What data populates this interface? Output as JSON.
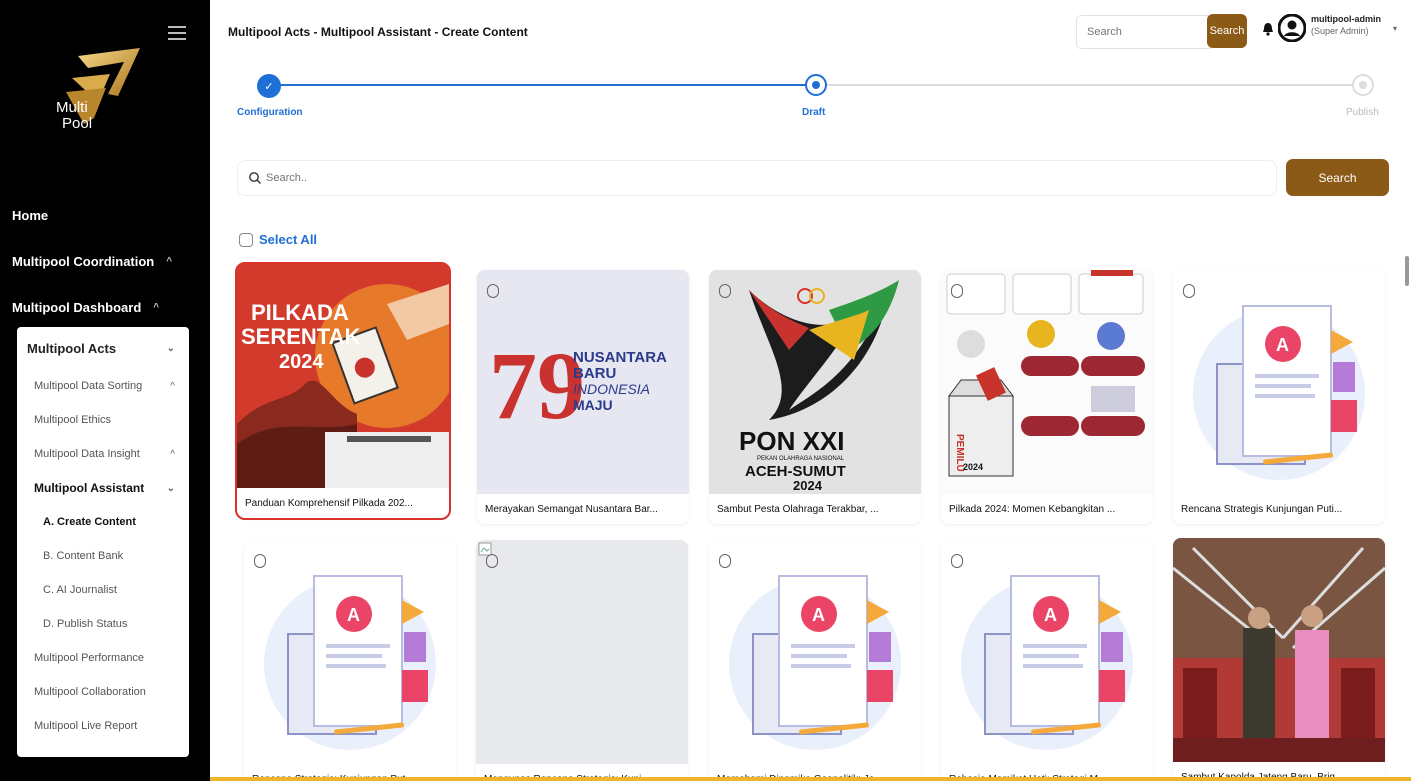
{
  "sidebar": {
    "logo_line1": "Multi",
    "logo_line2": "Pool",
    "nav": [
      {
        "label": "Home"
      },
      {
        "label": "Multipool Coordination"
      },
      {
        "label": "Multipool Dashboard"
      }
    ],
    "acts": {
      "label": "Multipool Acts",
      "items": [
        {
          "label": "Multipool Data Sorting"
        },
        {
          "label": "Multipool Ethics"
        },
        {
          "label": "Multipool Data Insight"
        },
        {
          "label": "Multipool Assistant"
        }
      ],
      "assistant_children": [
        {
          "label": "A. Create Content"
        },
        {
          "label": "B. Content Bank"
        },
        {
          "label": "C. AI Journalist"
        },
        {
          "label": "D. Publish Status"
        }
      ],
      "tail": [
        {
          "label": "Multipool Performance"
        },
        {
          "label": "Multipool Collaboration"
        },
        {
          "label": "Multipool Live Report"
        }
      ]
    }
  },
  "header": {
    "title": "Multipool Acts - Multipool Assistant - Create Content",
    "search_placeholder": "Search",
    "search_button": "Search",
    "user_name": "multipool-admin",
    "user_role": "(Super Admin)"
  },
  "stepper": {
    "steps": [
      {
        "label": "Configuration"
      },
      {
        "label": "Draft"
      },
      {
        "label": "Publish"
      }
    ],
    "check": "✓"
  },
  "content_search": {
    "placeholder": "Search..",
    "button": "Search"
  },
  "select_all": "Select All",
  "thumb_text": {
    "pilkada_l1": "PILKADA",
    "pilkada_l2": "SERENTAK",
    "pilkada_l3": "2024",
    "nusa_num": "79",
    "nusa_l1": "NUSANTARA",
    "nusa_l2": "BARU",
    "nusa_l3": "INDONESIA",
    "nusa_l4": "MAJU",
    "pon_l1": "PON XXI",
    "pon_l2": "PEKAN OLAHRAGA NASIONAL",
    "pon_l3": "ACEH-SUMUT",
    "pon_l4": "2024",
    "pemilu": "PEMILU",
    "pemilu_year": "2024",
    "doc_letter": "A"
  },
  "cards": [
    {
      "caption": "Panduan Komprehensif Pilkada 202...",
      "selected": true
    },
    {
      "caption": "Merayakan Semangat Nusantara Bar..."
    },
    {
      "caption": "Sambut Pesta Olahraga Terakbar, ..."
    },
    {
      "caption": "Pilkada 2024: Momen Kebangkitan ..."
    },
    {
      "caption": "Rencana Strategis Kunjungan Puti..."
    },
    {
      "caption": "Rencana Strategis: Kunjungan Put..."
    },
    {
      "caption": "Mengupas Rencana Strategis: Kunj..."
    },
    {
      "caption": "Memahami Dinamika Geopolitik: Je..."
    },
    {
      "caption": "Rahasia Memikat Hati: Strategi M..."
    },
    {
      "caption": "Sambut Kapolda Jateng Baru, Brig..."
    }
  ],
  "colors": {
    "accent": "#8b5a17",
    "primary": "#1f6fd6",
    "selected_border": "#d8322a"
  }
}
